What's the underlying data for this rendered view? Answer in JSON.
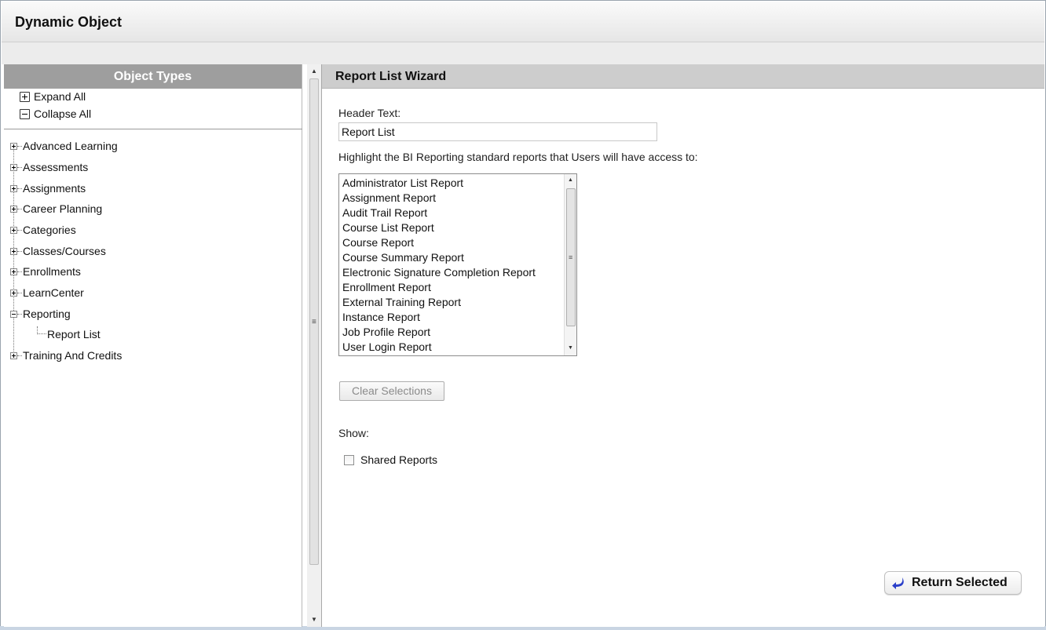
{
  "window": {
    "title": "Dynamic Object"
  },
  "left_panel": {
    "header": "Object Types",
    "expand_all": "Expand All",
    "collapse_all": "Collapse All",
    "tree": [
      {
        "label": "Advanced Learning",
        "state": "collapsed"
      },
      {
        "label": "Assessments",
        "state": "collapsed"
      },
      {
        "label": "Assignments",
        "state": "collapsed"
      },
      {
        "label": "Career Planning",
        "state": "collapsed"
      },
      {
        "label": "Categories",
        "state": "collapsed"
      },
      {
        "label": "Classes/Courses",
        "state": "collapsed"
      },
      {
        "label": "Enrollments",
        "state": "collapsed"
      },
      {
        "label": "LearnCenter",
        "state": "collapsed"
      },
      {
        "label": "Reporting",
        "state": "expanded",
        "children": [
          "Report List"
        ]
      },
      {
        "label": "Training And Credits",
        "state": "collapsed"
      }
    ]
  },
  "right_panel": {
    "header": "Report List Wizard",
    "header_text_label": "Header Text:",
    "header_text_value": "Report List",
    "instructions": "Highlight the BI Reporting standard reports that Users will have access to:",
    "reports": [
      "Administrator List Report",
      "Assignment Report",
      "Audit Trail Report",
      "Course List Report",
      "Course Report",
      "Course Summary Report",
      "Electronic Signature Completion Report",
      "Enrollment Report",
      "External Training Report",
      "Instance Report",
      "Job Profile Report",
      "User Login Report"
    ],
    "clear_button": "Clear Selections",
    "show_label": "Show:",
    "shared_reports_label": "Shared Reports",
    "shared_reports_checked": false,
    "return_button": "Return Selected"
  },
  "icons": {
    "return": "return-arrow-icon",
    "expand": "plus-box-icon",
    "collapse": "minus-box-icon"
  },
  "colors": {
    "left_header_bg": "#9e9e9e",
    "right_header_bg": "#cdcdcd",
    "return_arrow": "#2a3fc9"
  }
}
